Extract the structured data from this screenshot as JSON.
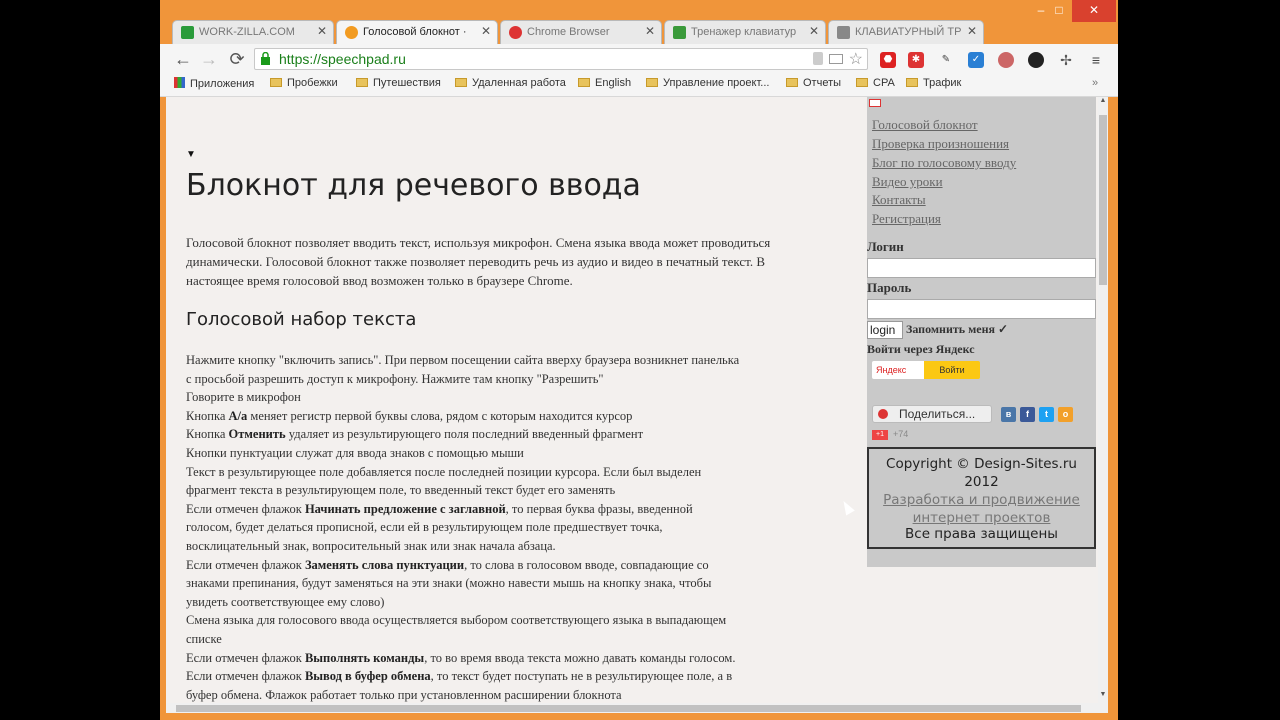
{
  "tabs": [
    {
      "label": "WORK-ZILLA.COM",
      "icon": "check-icon",
      "color": "#2a9b3a"
    },
    {
      "label": "Голосовой блокнот ·",
      "icon": "orange-globe-icon",
      "color": "#f29b21"
    },
    {
      "label": "Chrome Browser",
      "icon": "chrome-icon",
      "color": "#d33"
    },
    {
      "label": "Тренажер клавиатур",
      "icon": "green-doc-icon",
      "color": "#3a9a3a"
    },
    {
      "label": "КЛАВИАТУРНЫЙ ТР",
      "icon": "keyboard-icon",
      "color": "#888"
    }
  ],
  "window_controls": {
    "minimize": "‒",
    "maximize": "□",
    "close": "✕"
  },
  "nav": {
    "back": "←",
    "forward": "→",
    "reload": "⟳"
  },
  "address": {
    "url": "https://speechpad.ru"
  },
  "bookmarks": [
    {
      "label": "Приложения",
      "icon": "apps-grid-icon"
    },
    {
      "label": "Пробежки",
      "icon": "folder-icon"
    },
    {
      "label": "Путешествия",
      "icon": "folder-icon"
    },
    {
      "label": "Удаленная работа",
      "icon": "folder-icon"
    },
    {
      "label": "English",
      "icon": "folder-icon"
    },
    {
      "label": "Управление проект...",
      "icon": "folder-icon"
    },
    {
      "label": "Отчеты",
      "icon": "folder-icon"
    },
    {
      "label": "CPA",
      "icon": "folder-icon"
    },
    {
      "label": "Трафик",
      "icon": "folder-icon"
    }
  ],
  "bookmarks_more": "»",
  "page": {
    "triangle": "▼",
    "title": "Блокнот для речевого ввода",
    "intro": "Голосовой блокнот позволяет вводить текст, используя микрофон. Смена языка ввода может проводиться динамически. Голосовой блокнот также позволяет переводить речь из аудио и видео в печатный текст. В настоящее время голосовой ввод возможен только в браузере Chrome.",
    "subtitle": "Голосовой набор текста",
    "instructions": [
      {
        "pre": "Нажмите кнопку \"включить запись\". При первом посещении сайта вверху браузера возникнет панелька",
        "bold": "",
        "post": ""
      },
      {
        "pre": "с просьбой разрешить доступ к микрофону. Нажмите там кнопку \"Разрешить\"",
        "bold": "",
        "post": ""
      },
      {
        "pre": "Говорите в микрофон",
        "bold": "",
        "post": ""
      },
      {
        "pre": "Кнопка ",
        "bold": "A/a",
        "post": " меняет регистр первой буквы слова, рядом с которым находится курсор"
      },
      {
        "pre": "Кнопка ",
        "bold": "Отменить",
        "post": " удаляет из результирующего поля последний введенный фрагмент"
      },
      {
        "pre": "Кнопки пунктуации служат для ввода знаков с помощью мыши",
        "bold": "",
        "post": ""
      },
      {
        "pre": "Текст в результирующее поле добавляется после последней позиции курсора. Если был выделен",
        "bold": "",
        "post": ""
      },
      {
        "pre": "фрагмент текста в результирующем поле, то введенный текст будет его заменять",
        "bold": "",
        "post": ""
      },
      {
        "pre": "Если отмечен флажок ",
        "bold": "Начинать предложение с заглавной",
        "post": ", то первая буква фразы, введенной"
      },
      {
        "pre": "голосом, будет делаться прописной, если ей в результирующем поле предшествует точка,",
        "bold": "",
        "post": ""
      },
      {
        "pre": "восклицательный знак, вопросительный знак или знак начала абзаца.",
        "bold": "",
        "post": ""
      },
      {
        "pre": "Если отмечен флажок ",
        "bold": "Заменять слова пунктуации",
        "post": ", то слова в голосовом вводе, совпадающие со"
      },
      {
        "pre": "знаками препинания, будут заменяться на эти знаки (можно навести мышь на кнопку знака, чтобы",
        "bold": "",
        "post": ""
      },
      {
        "pre": "увидеть соответствующее ему слово)",
        "bold": "",
        "post": ""
      },
      {
        "pre": "Смена языка для голосового ввода осуществляется выбором соответствующего языка в выпадающем",
        "bold": "",
        "post": ""
      },
      {
        "pre": "списке",
        "bold": "",
        "post": ""
      },
      {
        "pre": "Если отмечен флажок ",
        "bold": "Выполнять команды",
        "post": ", то во время ввода текста можно давать команды голосом."
      },
      {
        "pre": "Если отмечен флажок ",
        "bold": "Вывод в буфер обмена",
        "post": ", то текст будет поступать не в результирующее поле, а в"
      },
      {
        "pre": "буфер обмена. Флажок работает только при установленном расширении блокнота",
        "bold": "",
        "post": ""
      }
    ]
  },
  "sidebar": {
    "nav": [
      "Голосовой блокнот",
      "Проверка произношения",
      "Блог по голосовому вводу",
      "Видео уроки",
      "Контакты",
      "Регистрация"
    ],
    "login_label": "Логин",
    "password_label": "Пароль",
    "login_button": "login",
    "remember_label": "Запомнить меня",
    "remember_mark": "✓",
    "yandex_label": "Войти через Яндекс",
    "yandex_logo": "Яндекс",
    "yandex_button": "Войти",
    "share_label": "Поделиться...",
    "social_icons": [
      "vk-icon",
      "facebook-icon",
      "twitter-icon",
      "odnoklassniki-icon"
    ],
    "gplus_label": "+1",
    "gplus_count": "+74"
  },
  "footer": {
    "copyright": "Copyright © Design-Sites.ru 2012",
    "dev_link": "Разработка и продвижение интернет проектов",
    "rights": "Все права защищены"
  }
}
